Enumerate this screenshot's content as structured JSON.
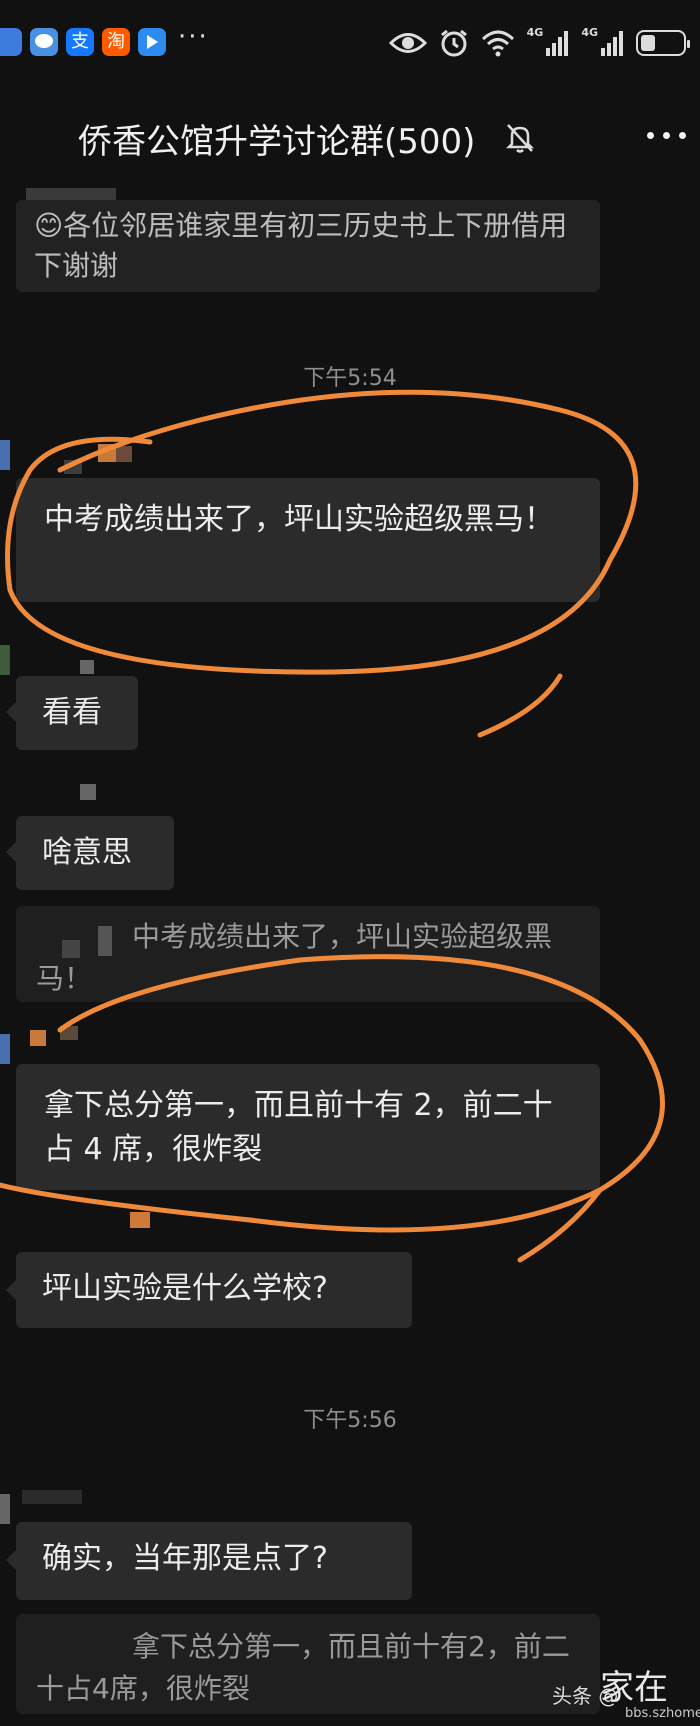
{
  "status_bar": {
    "apps": [
      {
        "icon": "app-icon-blue",
        "color": "#3d7bdc"
      },
      {
        "icon": "app-icon-chat",
        "color": "#4a90e2"
      },
      {
        "icon": "alipay-icon",
        "label": "支",
        "color": "#1677ff"
      },
      {
        "icon": "taobao-icon",
        "label": "淘",
        "color": "#ff5a00"
      },
      {
        "icon": "app-icon-arrow",
        "color": "#2e8bf0"
      }
    ],
    "more": "···",
    "network_1": "4G",
    "network_2": "4G"
  },
  "header": {
    "title": "侨香公馆升学讨论群(500)"
  },
  "messages": [
    {
      "kind": "bubble",
      "text": "😊各位邻居谁家里有初三历史书上下册借用下谢谢"
    },
    {
      "kind": "time",
      "text": "下午5:54"
    },
    {
      "kind": "bubble",
      "text": "中考成绩出来了，坪山实验超级黑马！"
    },
    {
      "kind": "bubble",
      "text": "看看"
    },
    {
      "kind": "bubble",
      "text": "啥意思"
    },
    {
      "kind": "quote",
      "text": "中考成绩出来了，坪山实验超级黑马！"
    },
    {
      "kind": "bubble",
      "text": "拿下总分第一，而且前十有 2，前二十占 4 席，很炸裂"
    },
    {
      "kind": "bubble",
      "text": "坪山实验是什么学校?"
    },
    {
      "kind": "time",
      "text": "下午5:56"
    },
    {
      "kind": "bubble",
      "text": "确实，当年那是点了?"
    },
    {
      "kind": "quote",
      "text": "拿下总分第一，而且前十有2，前二十占4席，很炸裂"
    }
  ],
  "watermark": {
    "source": "头条 @",
    "big": "家在",
    "url": "bbs.szhome.com"
  },
  "colors": {
    "background": "#111111",
    "bubble": "#2b2b2b",
    "annotation": "#f08a3a"
  }
}
